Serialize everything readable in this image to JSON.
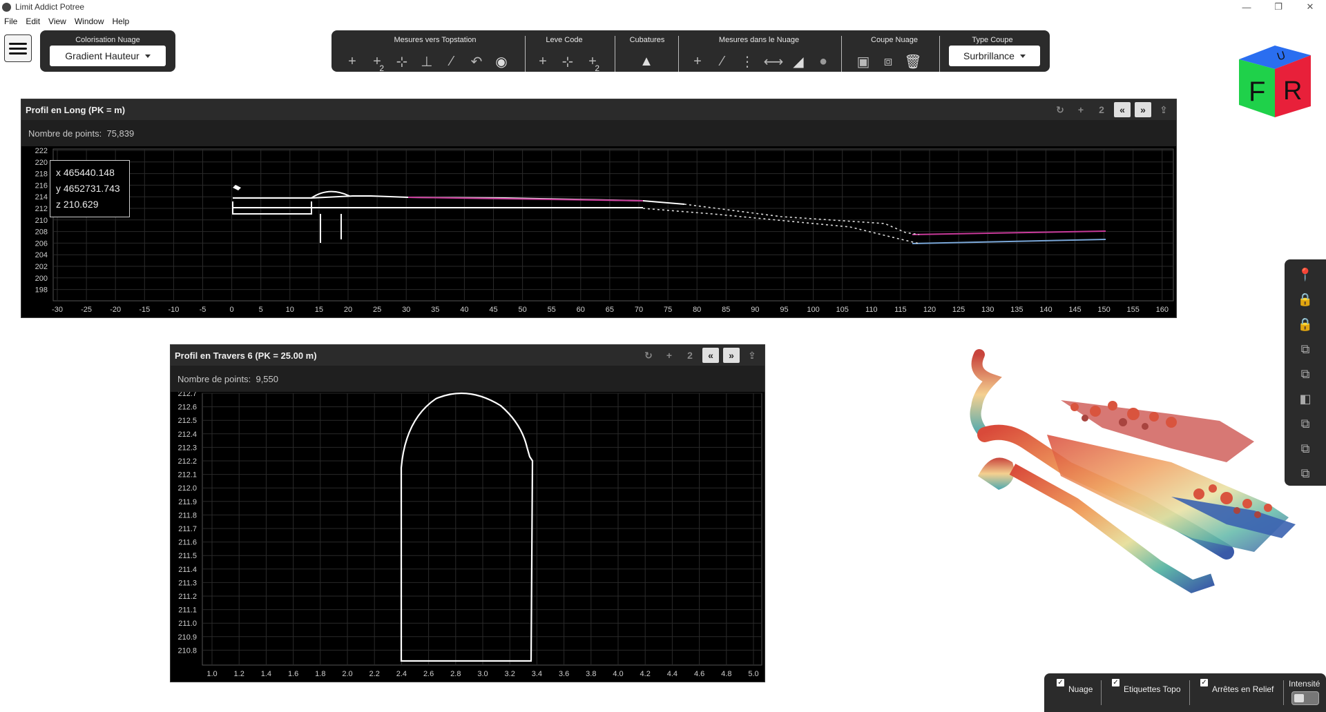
{
  "window": {
    "title": "Limit Addict Potree",
    "minimize": "—",
    "maximize": "❐",
    "close": "✕"
  },
  "menu": [
    "File",
    "Edit",
    "View",
    "Window",
    "Help"
  ],
  "colorisation": {
    "title": "Colorisation Nuage",
    "selected": "Gradient Hauteur"
  },
  "toolbar": {
    "groups": {
      "mesures_topstation": "Mesures vers Topstation",
      "leve_code": "Leve Code",
      "cubatures": "Cubatures",
      "mesures_nuage": "Mesures dans le Nuage",
      "coupe_nuage": "Coupe Nuage",
      "type_coupe": "Type Coupe"
    },
    "badge_2": "2",
    "type_coupe_selected": "Surbrillance"
  },
  "cube": {
    "top": "U",
    "front": "F",
    "right": "R",
    "colors": {
      "top": "#2a6ef0",
      "front": "#1fd14a",
      "right": "#e8203a"
    }
  },
  "profil_long": {
    "title": "Profil en Long (PK = m)",
    "points_label": "Nombre de points:",
    "points_value": "75,839",
    "badge": "2",
    "tooltip": {
      "x": "x 465440.148",
      "y": "y 4652731.743",
      "z": "z 210.629"
    },
    "y_ticks": [
      "222",
      "220",
      "218",
      "216",
      "214",
      "212",
      "210",
      "208",
      "206",
      "204",
      "202",
      "200",
      "198"
    ],
    "x_ticks": [
      "-30",
      "-25",
      "-20",
      "-15",
      "-10",
      "-5",
      "0",
      "5",
      "10",
      "15",
      "20",
      "25",
      "30",
      "35",
      "40",
      "45",
      "50",
      "55",
      "60",
      "65",
      "70",
      "75",
      "80",
      "85",
      "90",
      "95",
      "100",
      "105",
      "110",
      "115",
      "120",
      "125",
      "130",
      "135",
      "140",
      "145",
      "150",
      "155",
      "160"
    ]
  },
  "profil_travers": {
    "title": "Profil en Travers 6 (PK = 25.00 m)",
    "points_label": "Nombre de points:",
    "points_value": "9,550",
    "badge": "2",
    "y_ticks": [
      "212.7",
      "212.6",
      "212.5",
      "212.4",
      "212.3",
      "212.2",
      "212.1",
      "212.0",
      "211.9",
      "211.8",
      "211.7",
      "211.6",
      "211.5",
      "211.4",
      "211.3",
      "211.2",
      "211.1",
      "211.0",
      "210.9",
      "210.8"
    ],
    "x_ticks": [
      "1.0",
      "1.2",
      "1.4",
      "1.6",
      "1.8",
      "2.0",
      "2.2",
      "2.4",
      "2.6",
      "2.8",
      "3.0",
      "3.2",
      "3.4",
      "3.6",
      "3.8",
      "4.0",
      "4.2",
      "4.4",
      "4.6",
      "4.8",
      "5.0"
    ]
  },
  "bottom": {
    "nuage": "Nuage",
    "etiquettes": "Etiquettes Topo",
    "arretes": "Arrêtes en Relief",
    "intensite": "Intensité",
    "check": "✓"
  }
}
